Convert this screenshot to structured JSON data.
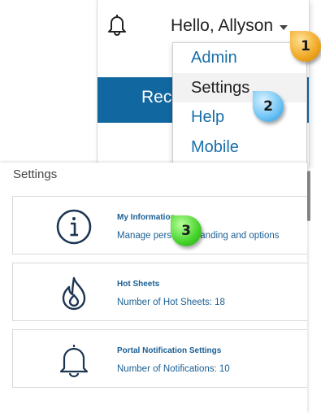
{
  "header": {
    "greeting": "Hello, Allyson",
    "blue_strip_text": "Rec"
  },
  "dropdown": {
    "items": [
      {
        "label": "Admin"
      },
      {
        "label": "Settings"
      },
      {
        "label": "Help"
      },
      {
        "label": "Mobile"
      }
    ]
  },
  "settings": {
    "title": "Settings",
    "cards": [
      {
        "title": "My Information",
        "subtitle": "Manage personal branding and options",
        "icon": "info-icon"
      },
      {
        "title": "Hot Sheets",
        "subtitle": "Number of Hot Sheets: 18",
        "icon": "flame-icon"
      },
      {
        "title": "Portal Notification Settings",
        "subtitle": "Number of Notifications: 10",
        "icon": "bell-icon"
      }
    ]
  },
  "badges": [
    "1",
    "2",
    "3"
  ],
  "colors": {
    "brand_blue": "#11679f",
    "link_blue": "#1a6fa8",
    "badge_orange": "#f0a720",
    "badge_blue": "#6cc3f5",
    "badge_green": "#45d22a"
  }
}
